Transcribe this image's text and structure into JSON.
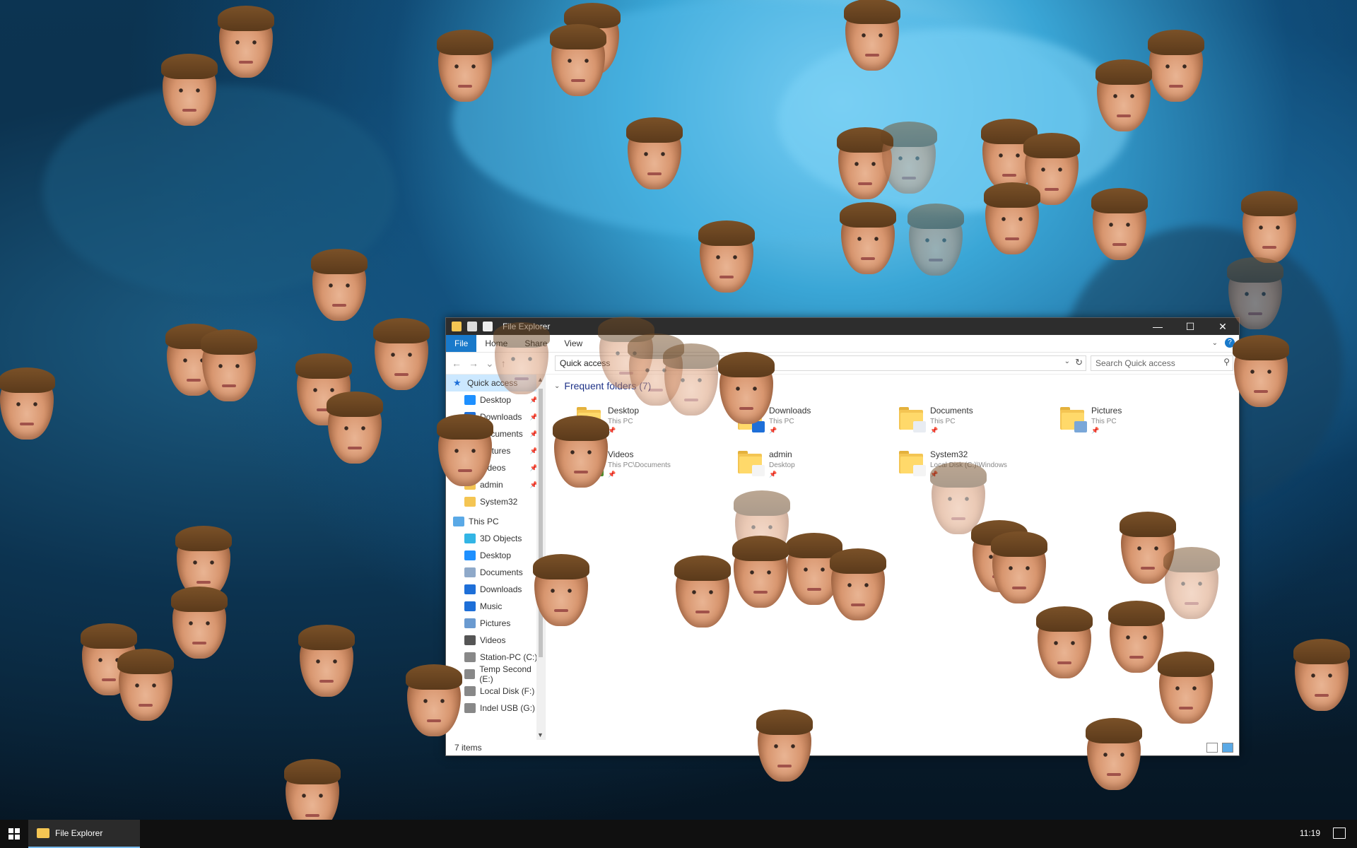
{
  "window": {
    "title": "File Explorer",
    "controls": {
      "minimize": "—",
      "maximize": "☐",
      "close": "✕"
    }
  },
  "ribbon": {
    "tabs": [
      "File",
      "Home",
      "Share",
      "View"
    ],
    "help": "?"
  },
  "address": {
    "path": "Quick access",
    "search_placeholder": "Search Quick access"
  },
  "nav": {
    "quick_access": "Quick access",
    "items": [
      {
        "label": "Desktop",
        "icon": "desktop-icon",
        "color": "#1e90ff",
        "pinned": true
      },
      {
        "label": "Downloads",
        "icon": "download-icon",
        "color": "#1e6fd8",
        "pinned": true
      },
      {
        "label": "Documents",
        "icon": "document-icon",
        "color": "#8fa9c9",
        "pinned": true
      },
      {
        "label": "Pictures",
        "icon": "picture-icon",
        "color": "#6a9ad0",
        "pinned": true
      },
      {
        "label": "Videos",
        "icon": "video-icon",
        "color": "#555555",
        "pinned": true
      },
      {
        "label": "admin",
        "icon": "folder-icon",
        "color": "#f4c553",
        "pinned": true
      },
      {
        "label": "System32",
        "icon": "folder-icon",
        "color": "#f4c553",
        "pinned": false
      }
    ],
    "this_pc": "This PC",
    "pc_items": [
      {
        "label": "3D Objects",
        "icon": "cube-icon",
        "color": "#33b5e5"
      },
      {
        "label": "Desktop",
        "icon": "desktop-icon",
        "color": "#1e90ff"
      },
      {
        "label": "Documents",
        "icon": "document-icon",
        "color": "#8fa9c9"
      },
      {
        "label": "Downloads",
        "icon": "download-icon",
        "color": "#1e6fd8"
      },
      {
        "label": "Music",
        "icon": "music-icon",
        "color": "#1e6fd8"
      },
      {
        "label": "Pictures",
        "icon": "picture-icon",
        "color": "#6a9ad0"
      },
      {
        "label": "Videos",
        "icon": "video-icon",
        "color": "#555555"
      },
      {
        "label": "Station-PC (C:)",
        "icon": "drive-icon",
        "color": "#888888"
      },
      {
        "label": "Temp Second (E:)",
        "icon": "drive-icon",
        "color": "#888888"
      },
      {
        "label": "Local Disk (F:)",
        "icon": "drive-icon",
        "color": "#888888"
      },
      {
        "label": "Indel USB (G:)",
        "icon": "drive-icon",
        "color": "#888888"
      }
    ]
  },
  "main": {
    "group_title": "Frequent folders (7)",
    "folders": [
      {
        "name": "Desktop",
        "sub": "This PC",
        "badge": "#1e90ff"
      },
      {
        "name": "Downloads",
        "sub": "This PC",
        "badge": "#1e6fd8"
      },
      {
        "name": "Documents",
        "sub": "This PC",
        "badge": "#e8ecf2"
      },
      {
        "name": "Pictures",
        "sub": "This PC",
        "badge": "#7aa7d8"
      },
      {
        "name": "Videos",
        "sub": "This PC\\Documents",
        "badge": "#4d8a2b"
      },
      {
        "name": "admin",
        "sub": "Desktop",
        "badge": "#f4f4f4"
      },
      {
        "name": "System32",
        "sub": "Local Disk (C:)\\Windows",
        "badge": "#f4f4f4"
      }
    ]
  },
  "status": {
    "items": "7 items"
  },
  "taskbar": {
    "app": "File Explorer",
    "clock": "11:19"
  }
}
